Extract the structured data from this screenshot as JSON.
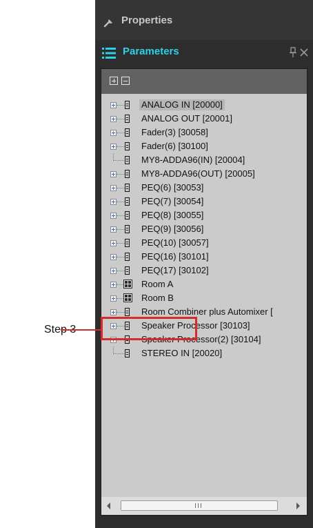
{
  "panel": {
    "properties_title": "Properties",
    "parameters_title": "Parameters"
  },
  "toolbar": {
    "expand_all_icon": "expand-all-icon",
    "collapse_all_icon": "collapse-all-icon"
  },
  "tree": {
    "items": [
      {
        "label": "ANALOG IN [20000]",
        "icon": "module-icon",
        "expandable": true,
        "selected": true
      },
      {
        "label": "ANALOG OUT [20001]",
        "icon": "module-icon",
        "expandable": true
      },
      {
        "label": "Fader(3) [30058]",
        "icon": "module-icon",
        "expandable": true
      },
      {
        "label": "Fader(6) [30100]",
        "icon": "module-icon",
        "expandable": true
      },
      {
        "label": "MY8-ADDA96(IN) [20004]",
        "icon": "module-icon",
        "expandable": false
      },
      {
        "label": "MY8-ADDA96(OUT) [20005]",
        "icon": "module-icon",
        "expandable": true
      },
      {
        "label": "PEQ(6) [30053]",
        "icon": "module-icon",
        "expandable": true
      },
      {
        "label": "PEQ(7) [30054]",
        "icon": "module-icon",
        "expandable": true
      },
      {
        "label": "PEQ(8) [30055]",
        "icon": "module-icon",
        "expandable": true
      },
      {
        "label": "PEQ(9) [30056]",
        "icon": "module-icon",
        "expandable": true
      },
      {
        "label": "PEQ(10) [30057]",
        "icon": "module-icon",
        "expandable": true
      },
      {
        "label": "PEQ(16) [30101]",
        "icon": "module-icon",
        "expandable": true
      },
      {
        "label": "PEQ(17) [30102]",
        "icon": "module-icon",
        "expandable": true
      },
      {
        "label": "Room A",
        "icon": "room-icon",
        "expandable": true
      },
      {
        "label": "Room B",
        "icon": "room-icon",
        "expandable": true
      },
      {
        "label": "Room Combiner plus Automixer [",
        "icon": "module-icon",
        "expandable": true
      },
      {
        "label": "Speaker Processor [30103]",
        "icon": "module-icon",
        "expandable": true
      },
      {
        "label": "Speaker Processor(2) [30104]",
        "icon": "module-icon",
        "expandable": true
      },
      {
        "label": "STEREO IN [20020]",
        "icon": "module-icon",
        "expandable": false
      }
    ]
  },
  "annotation": {
    "label": "Step 3",
    "color": "#d52b2b"
  },
  "colors": {
    "accent": "#2bd2e8",
    "panel_bg": "#2d2d2d",
    "tree_bg": "#cbcbcb"
  }
}
